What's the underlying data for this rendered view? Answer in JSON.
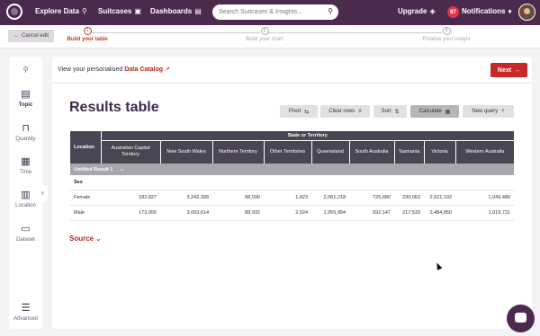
{
  "topnav": {
    "explore_label": "Explore Data",
    "suitcases_label": "Suitcases",
    "dashboards_label": "Dashboards",
    "search_placeholder": "Search Suitcases & Insights...",
    "upgrade_label": "Upgrade",
    "notifications_count": "87",
    "notifications_label": "Notifications"
  },
  "stepper": {
    "cancel_label": "Cancel edit",
    "steps": [
      {
        "num": "1",
        "label": "Build your table"
      },
      {
        "num": "2",
        "label": "Build your chart"
      },
      {
        "num": "3",
        "label": "Finalise your insight"
      }
    ]
  },
  "sidebar": {
    "items": [
      {
        "label": "Topic",
        "icon": "document-icon"
      },
      {
        "label": "Quantity",
        "icon": "bookmark-icon"
      },
      {
        "label": "Time",
        "icon": "calendar-icon"
      },
      {
        "label": "Location",
        "icon": "map-icon"
      },
      {
        "label": "Dataset",
        "icon": "folder-icon"
      },
      {
        "label": "Advanced",
        "icon": "sliders-icon"
      }
    ]
  },
  "main": {
    "catalog_prefix": "View your personalised",
    "catalog_link": "Data Catalog",
    "next_label": "Next",
    "title": "Results table",
    "toolbar": {
      "pivot": "Pivot",
      "clear_rows": "Clear rows",
      "sort": "Sort",
      "calculate": "Calculate",
      "new_query": "New query"
    },
    "source_label": "Source"
  },
  "table": {
    "location_header": "Location",
    "group_header": "State or Territory",
    "columns": [
      "Australian Capital Territory",
      "New South Wales",
      "Northern Territory",
      "Other Territories",
      "Queensland",
      "South Australia",
      "Tasmania",
      "Victoria",
      "Western Australia"
    ],
    "result_group": "Untitled Result 1",
    "section_label": "Sex",
    "rows": [
      {
        "label": "Female",
        "values": [
          "182,827",
          "3,242,308",
          "88,030",
          "1,823",
          "2,061,218",
          "725,680",
          "230,063",
          "2,621,192",
          "1,049,486"
        ]
      },
      {
        "label": "Male",
        "values": [
          "173,955",
          "3,093,614",
          "88,932",
          "2,024",
          "1,955,994",
          "692,147",
          "217,533",
          "2,484,850",
          "1,019,731"
        ]
      }
    ]
  },
  "colors": {
    "nav_bg": "#4a2a4d",
    "accent": "#c62828",
    "header_bg": "#4a4552"
  }
}
